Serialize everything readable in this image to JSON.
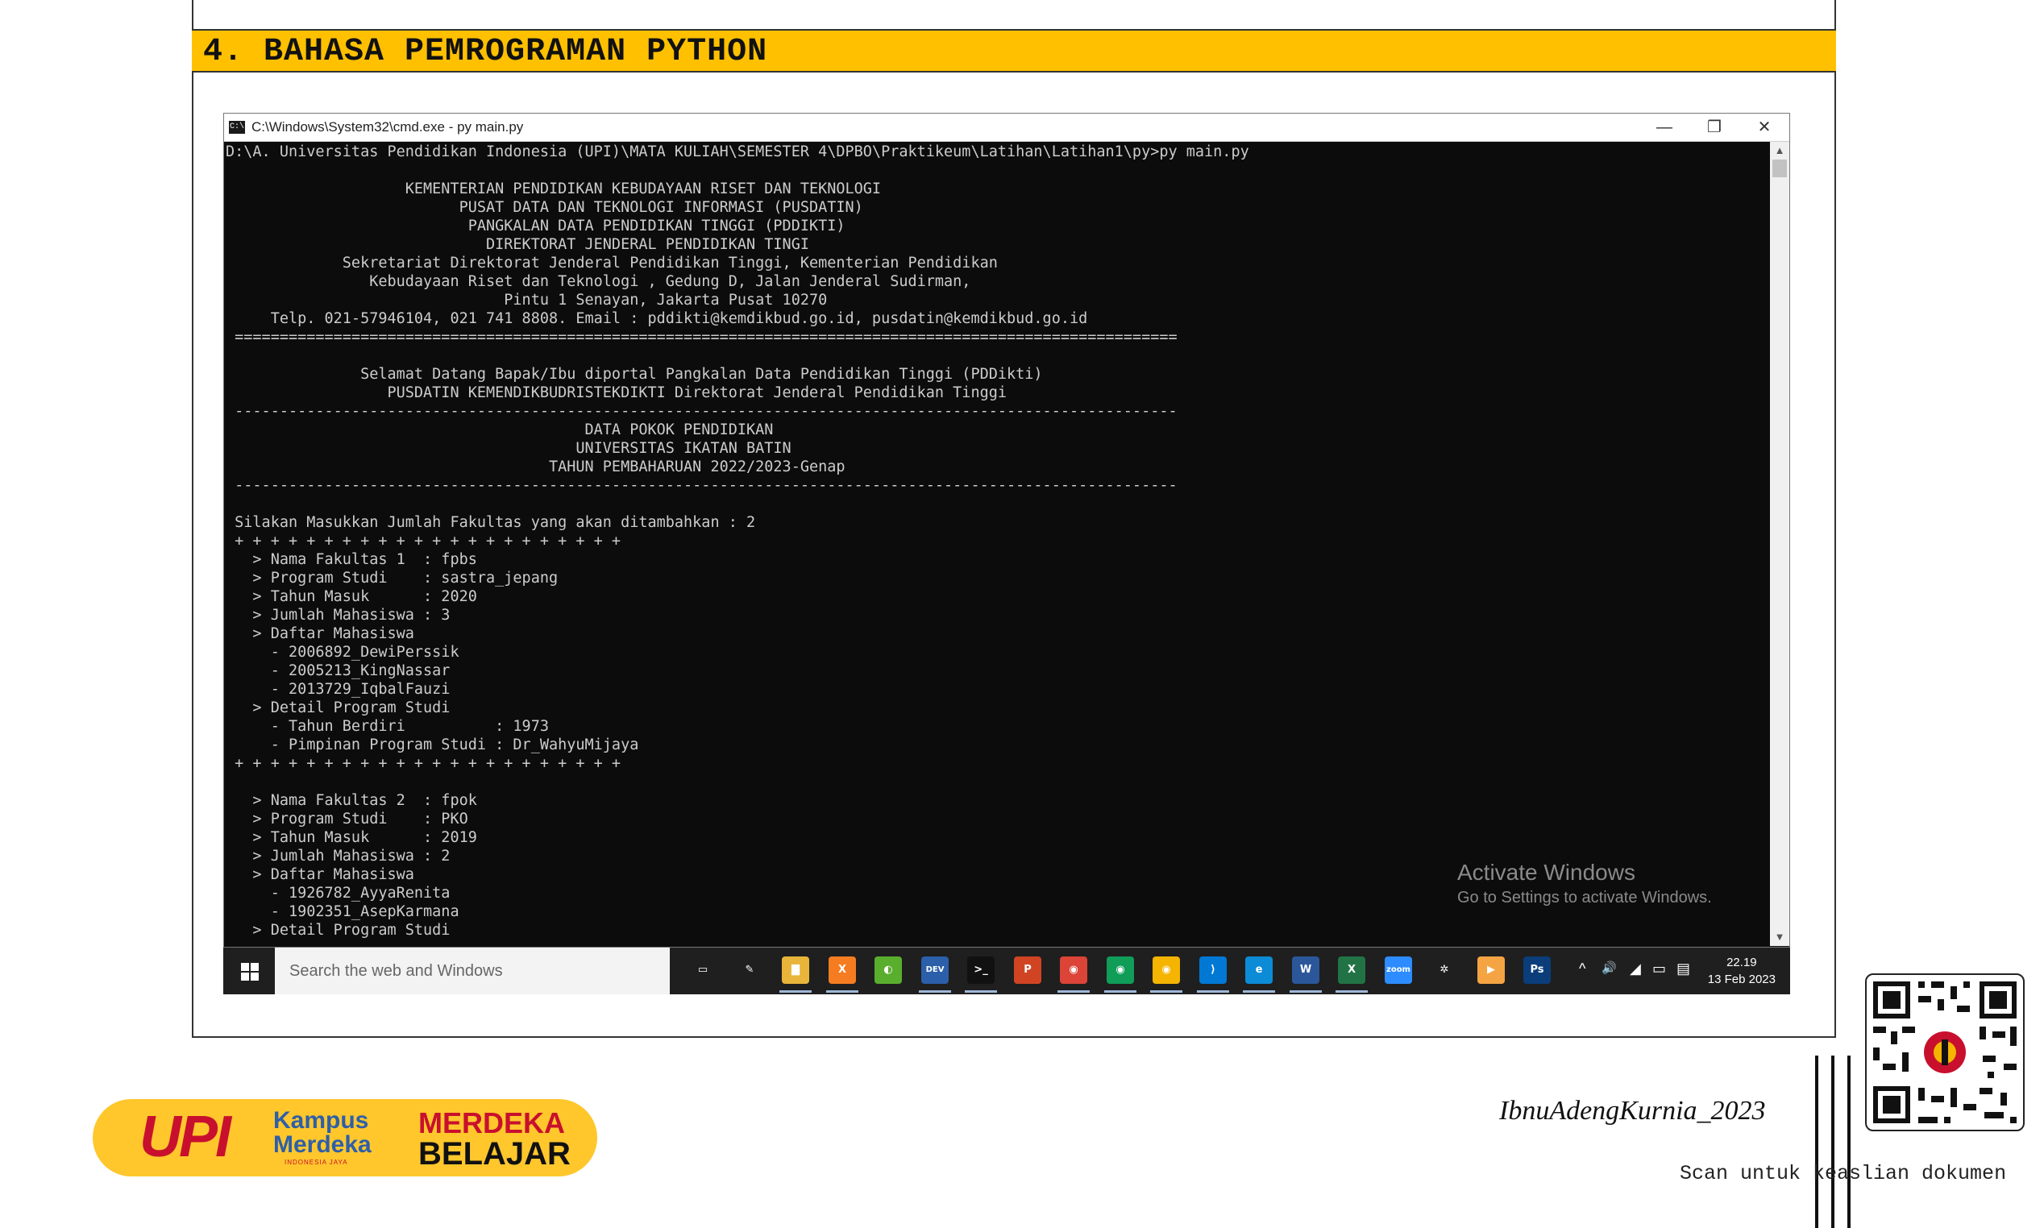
{
  "section": {
    "title": "4. BAHASA PEMROGRAMAN PYTHON"
  },
  "cmd": {
    "window_title": "C:\\Windows\\System32\\cmd.exe - py  main.py",
    "icon_text": "C:\\",
    "minimize": "—",
    "restore": "❐",
    "close": "✕",
    "lines": [
      "D:\\A. Universitas Pendidikan Indonesia (UPI)\\MATA KULIAH\\SEMESTER 4\\DPBO\\Praktikeum\\Latihan\\Latihan1\\py>py main.py",
      "",
      "                    KEMENTERIAN PENDIDIKAN KEBUDAYAAN RISET DAN TEKNOLOGI",
      "                          PUSAT DATA DAN TEKNOLOGI INFORMASI (PUSDATIN)",
      "                           PANGKALAN DATA PENDIDIKAN TINGGI (PDDIKTI)",
      "                             DIREKTORAT JENDERAL PENDIDIKAN TINGI",
      "             Sekretariat Direktorat Jenderal Pendidikan Tinggi, Kementerian Pendidikan",
      "                Kebudayaan Riset dan Teknologi , Gedung D, Jalan Jenderal Sudirman,",
      "                               Pintu 1 Senayan, Jakarta Pusat 10270",
      "     Telp. 021-57946104, 021 741 8808. Email : pddikti@kemdikbud.go.id, pusdatin@kemdikbud.go.id",
      " =========================================================================================================",
      "",
      "               Selamat Datang Bapak/Ibu diportal Pangkalan Data Pendidikan Tinggi (PDDikti)",
      "                  PUSDATIN KEMENDIKBUDRISTEKDIKTI Direktorat Jenderal Pendidikan Tinggi",
      " ---------------------------------------------------------------------------------------------------------",
      "                                        DATA POKOK PENDIDIKAN",
      "                                       UNIVERSITAS IKATAN BATIN",
      "                                    TAHUN PEMBAHARUAN 2022/2023-Genap",
      " ---------------------------------------------------------------------------------------------------------",
      "",
      " Silakan Masukkan Jumlah Fakultas yang akan ditambahkan : 2",
      " + + + + + + + + + + + + + + + + + + + + + +",
      "   > Nama Fakultas 1  : fpbs",
      "   > Program Studi    : sastra_jepang",
      "   > Tahun Masuk      : 2020",
      "   > Jumlah Mahasiswa : 3",
      "   > Daftar Mahasiswa",
      "     - 2006892_DewiPerssik",
      "     - 2005213_KingNassar",
      "     - 2013729_IqbalFauzi",
      "   > Detail Program Studi",
      "     - Tahun Berdiri          : 1973",
      "     - Pimpinan Program Studi : Dr_WahyuMijaya",
      " + + + + + + + + + + + + + + + + + + + + + +",
      "",
      "   > Nama Fakultas 2  : fpok",
      "   > Program Studi    : PKO",
      "   > Tahun Masuk      : 2019",
      "   > Jumlah Mahasiswa : 2",
      "   > Daftar Mahasiswa",
      "     - 1926782_AyyaRenita",
      "     - 1902351_AsepKarmana",
      "   > Detail Program Studi"
    ],
    "activate_title": "Activate Windows",
    "activate_sub": "Go to Settings to activate Windows."
  },
  "taskbar": {
    "search_placeholder": "Search the web and Windows",
    "icons": [
      {
        "name": "task-view-icon",
        "label": "▭",
        "color": "#1f1f1f"
      },
      {
        "name": "pen-tool-icon",
        "label": "✎",
        "color": "#1f1f1f"
      },
      {
        "name": "file-explorer-icon",
        "label": "▇",
        "color": "#E8B43A"
      },
      {
        "name": "xampp-icon",
        "label": "X",
        "color": "#F57C20"
      },
      {
        "name": "green-app-icon",
        "label": "◐",
        "color": "#5AAE2E"
      },
      {
        "name": "dev-cpp-icon",
        "label": "DEV",
        "color": "#2B5FA9"
      },
      {
        "name": "command-prompt-icon",
        "label": ">_",
        "color": "#111111"
      },
      {
        "name": "powerpoint-icon",
        "label": "P",
        "color": "#D04423"
      },
      {
        "name": "chrome-icon-1",
        "label": "◉",
        "color": "#DB4437"
      },
      {
        "name": "chrome-icon-2",
        "label": "◉",
        "color": "#0F9D58"
      },
      {
        "name": "chrome-icon-3",
        "label": "◉",
        "color": "#F4B400"
      },
      {
        "name": "vscode-icon",
        "label": "⟩",
        "color": "#0078D4"
      },
      {
        "name": "edge-icon",
        "label": "e",
        "color": "#0C8BD6"
      },
      {
        "name": "word-icon",
        "label": "W",
        "color": "#2B579A"
      },
      {
        "name": "excel-icon",
        "label": "X",
        "color": "#217346"
      },
      {
        "name": "zoom-icon",
        "label": "zoom",
        "color": "#2D8CFF"
      },
      {
        "name": "settings-app-icon",
        "label": "✲",
        "color": "#1f1f1f"
      },
      {
        "name": "media-player-icon",
        "label": "▶",
        "color": "#F4A442"
      },
      {
        "name": "photoshop-icon",
        "label": "Ps",
        "color": "#0B3D7A"
      }
    ],
    "tray_chevron": "^",
    "tray_volume": "🔊",
    "tray_network": "◢",
    "tray_battery": "▭",
    "tray_notification": "▤",
    "time": "22.19",
    "date": "13 Feb 2023"
  },
  "footer": {
    "upi_logo": "UPI",
    "kampus_merdeka": "Kampus Merdeka",
    "kampus_small": "INDONESIA JAYA",
    "merdeka": "MERDEKA",
    "belajar": "BELAJAR",
    "author": "IbnuAdengKurnia_2023",
    "scan_text": "Scan untuk keaslian dokumen"
  }
}
